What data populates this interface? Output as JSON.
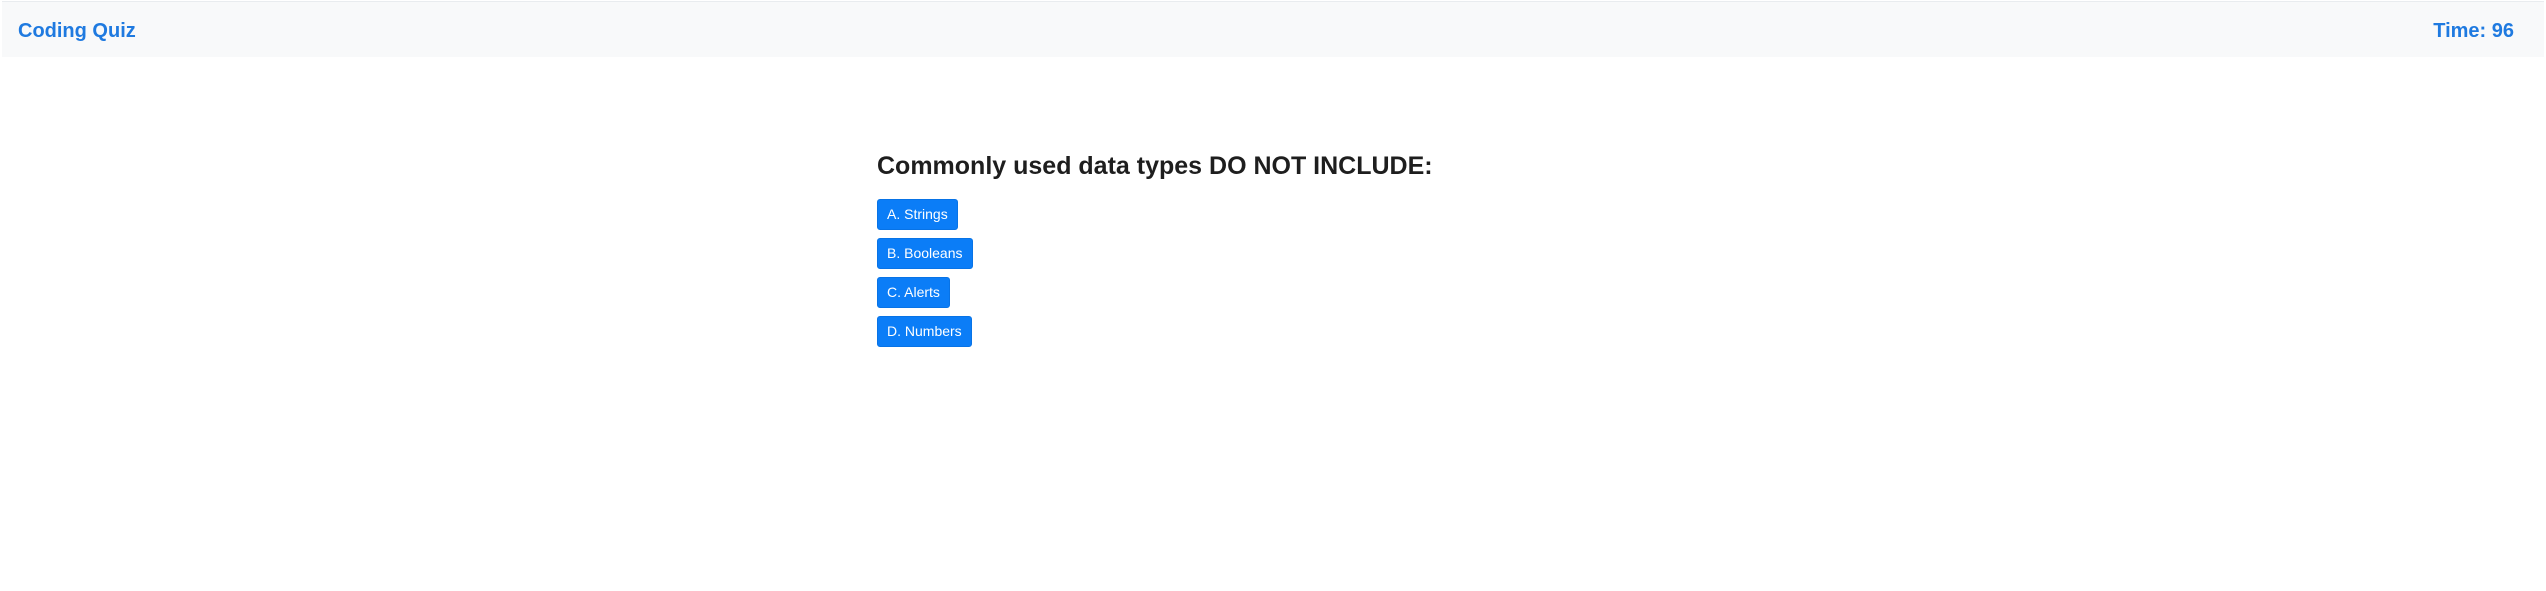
{
  "header": {
    "brand": "Coding Quiz",
    "timer": "Time: 96"
  },
  "quiz": {
    "question": "Commonly used data types DO NOT INCLUDE:",
    "choices": [
      "A. Strings",
      "B. Booleans",
      "C. Alerts",
      "D. Numbers"
    ]
  },
  "colors": {
    "accent": "#1f7ae0",
    "button": "#0b7df7",
    "header_background": "#f8f9fa"
  }
}
